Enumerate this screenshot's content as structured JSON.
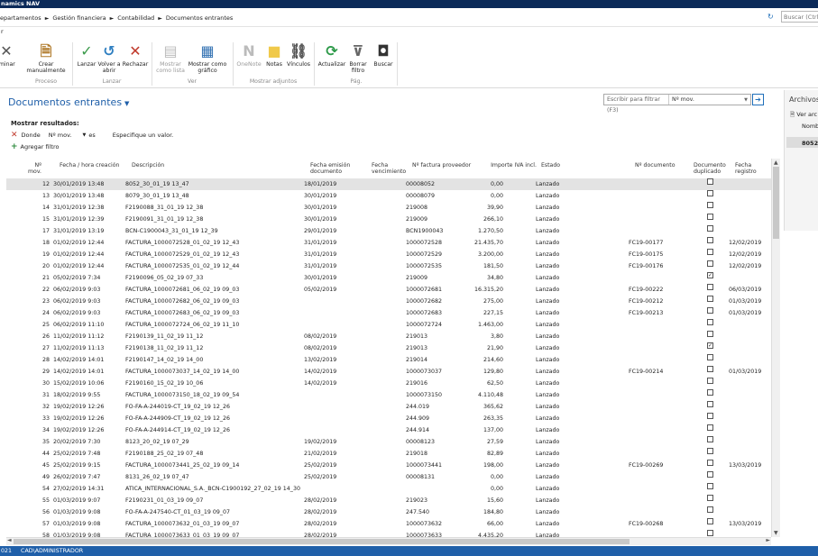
{
  "app": {
    "title": "namics NAV"
  },
  "nav": {
    "breadcrumb": [
      "epartamentos",
      "Gestión financiera",
      "Contabilidad",
      "Documentos entrantes"
    ],
    "search_placeholder": "Buscar (Ctrl+"
  },
  "menu": {
    "label": "r"
  },
  "ribbon": {
    "buttons": [
      {
        "label": "iminar",
        "icon": "delete-icon"
      },
      {
        "label": "Crear manualmente",
        "icon": "create-document-icon"
      },
      {
        "label": "Lanzar",
        "icon": "checkmark-icon"
      },
      {
        "label": "Volver a abrir",
        "icon": "reopen-icon"
      },
      {
        "label": "Rechazar",
        "icon": "reject-icon"
      },
      {
        "label": "Mostrar como lista",
        "icon": "list-view-icon"
      },
      {
        "label": "Mostrar como gráfico",
        "icon": "chart-view-icon"
      },
      {
        "label": "OneNote",
        "icon": "onenote-icon"
      },
      {
        "label": "Notas",
        "icon": "notes-icon"
      },
      {
        "label": "Vínculos",
        "icon": "links-icon"
      },
      {
        "label": "Actualizar",
        "icon": "refresh-icon"
      },
      {
        "label": "Borrar filtro",
        "icon": "clear-filter-icon"
      },
      {
        "label": "Buscar",
        "icon": "binoculars-icon"
      }
    ],
    "groups": [
      "Proceso",
      "Lanzar",
      "Ver",
      "Mostrar adjuntos",
      "Pág."
    ]
  },
  "page": {
    "title": "Documentos entrantes",
    "filter_placeholder": "Escribir para filtrar (F3)",
    "filter_field": "Nº mov."
  },
  "filters": {
    "show_label": "Mostrar resultados:",
    "where_label": "Donde",
    "field": "Nº mov.",
    "operator_label": "es",
    "value_placeholder": "Especifique un valor.",
    "add_label": "Agregar filtro"
  },
  "table": {
    "columns": [
      "Nº mov.",
      "Fecha / hora creación",
      "Descripción",
      "Fecha emisión documento",
      "Fecha vencimiento",
      "Nº factura proveedor",
      "Importe IVA incl.",
      "Estado",
      "Nº documento",
      "Documento duplicado",
      "Fecha registro"
    ],
    "rows": [
      {
        "no": "12",
        "created": "30/01/2019 13:48",
        "desc": "8052_30_01_19 13_47",
        "issue": "18/01/2019",
        "due": "",
        "inv": "00008052",
        "amt": "0,00",
        "status": "Lanzado",
        "doc": "",
        "dup": false,
        "reg": ""
      },
      {
        "no": "13",
        "created": "30/01/2019 13:48",
        "desc": "8079_30_01_19 13_48",
        "issue": "30/01/2019",
        "due": "",
        "inv": "00008079",
        "amt": "0,00",
        "status": "Lanzado",
        "doc": "",
        "dup": false,
        "reg": ""
      },
      {
        "no": "14",
        "created": "31/01/2019 12:38",
        "desc": "F2190088_31_01_19 12_38",
        "issue": "30/01/2019",
        "due": "",
        "inv": "219008",
        "amt": "39,90",
        "status": "Lanzado",
        "doc": "",
        "dup": false,
        "reg": ""
      },
      {
        "no": "15",
        "created": "31/01/2019 12:39",
        "desc": "F2190091_31_01_19 12_38",
        "issue": "30/01/2019",
        "due": "",
        "inv": "219009",
        "amt": "266,10",
        "status": "Lanzado",
        "doc": "",
        "dup": false,
        "reg": ""
      },
      {
        "no": "17",
        "created": "31/01/2019 13:19",
        "desc": "BCN-C1900043_31_01_19 12_39",
        "issue": "29/01/2019",
        "due": "",
        "inv": "BCN1900043",
        "amt": "1.270,50",
        "status": "Lanzado",
        "doc": "",
        "dup": false,
        "reg": ""
      },
      {
        "no": "18",
        "created": "01/02/2019 12:44",
        "desc": "FACTURA_1000072528_01_02_19 12_43",
        "issue": "31/01/2019",
        "due": "",
        "inv": "1000072528",
        "amt": "21.435,70",
        "status": "Lanzado",
        "doc": "FC19-00177",
        "dup": false,
        "reg": "12/02/2019"
      },
      {
        "no": "19",
        "created": "01/02/2019 12:44",
        "desc": "FACTURA_1000072529_01_02_19 12_43",
        "issue": "31/01/2019",
        "due": "",
        "inv": "1000072529",
        "amt": "3.200,00",
        "status": "Lanzado",
        "doc": "FC19-00175",
        "dup": false,
        "reg": "12/02/2019"
      },
      {
        "no": "20",
        "created": "01/02/2019 12:44",
        "desc": "FACTURA_1000072535_01_02_19 12_44",
        "issue": "31/01/2019",
        "due": "",
        "inv": "1000072535",
        "amt": "181,50",
        "status": "Lanzado",
        "doc": "FC19-00176",
        "dup": false,
        "reg": "12/02/2019"
      },
      {
        "no": "21",
        "created": "05/02/2019 7:34",
        "desc": "F2190096_05_02_19 07_33",
        "issue": "30/01/2019",
        "due": "",
        "inv": "219009",
        "amt": "34,80",
        "status": "Lanzado",
        "doc": "",
        "dup": true,
        "reg": ""
      },
      {
        "no": "22",
        "created": "06/02/2019 9:03",
        "desc": "FACTURA_1000072681_06_02_19 09_03",
        "issue": "05/02/2019",
        "due": "",
        "inv": "1000072681",
        "amt": "16.315,20",
        "status": "Lanzado",
        "doc": "FC19-00222",
        "dup": false,
        "reg": "06/03/2019"
      },
      {
        "no": "23",
        "created": "06/02/2019 9:03",
        "desc": "FACTURA_1000072682_06_02_19 09_03",
        "issue": "",
        "due": "",
        "inv": "1000072682",
        "amt": "275,00",
        "status": "Lanzado",
        "doc": "FC19-00212",
        "dup": false,
        "reg": "01/03/2019"
      },
      {
        "no": "24",
        "created": "06/02/2019 9:03",
        "desc": "FACTURA_1000072683_06_02_19 09_03",
        "issue": "",
        "due": "",
        "inv": "1000072683",
        "amt": "227,15",
        "status": "Lanzado",
        "doc": "FC19-00213",
        "dup": false,
        "reg": "01/03/2019"
      },
      {
        "no": "25",
        "created": "06/02/2019 11:10",
        "desc": "FACTURA_1000072724_06_02_19 11_10",
        "issue": "",
        "due": "",
        "inv": "1000072724",
        "amt": "1.463,00",
        "status": "Lanzado",
        "doc": "",
        "dup": false,
        "reg": ""
      },
      {
        "no": "26",
        "created": "11/02/2019 11:12",
        "desc": "F2190139_11_02_19 11_12",
        "issue": "08/02/2019",
        "due": "",
        "inv": "219013",
        "amt": "3,80",
        "status": "Lanzado",
        "doc": "",
        "dup": false,
        "reg": ""
      },
      {
        "no": "27",
        "created": "11/02/2019 11:13",
        "desc": "F2190138_11_02_19 11_12",
        "issue": "08/02/2019",
        "due": "",
        "inv": "219013",
        "amt": "21,90",
        "status": "Lanzado",
        "doc": "",
        "dup": true,
        "reg": ""
      },
      {
        "no": "28",
        "created": "14/02/2019 14:01",
        "desc": "F2190147_14_02_19 14_00",
        "issue": "13/02/2019",
        "due": "",
        "inv": "219014",
        "amt": "214,60",
        "status": "Lanzado",
        "doc": "",
        "dup": false,
        "reg": ""
      },
      {
        "no": "29",
        "created": "14/02/2019 14:01",
        "desc": "FACTURA_1000073037_14_02_19 14_00",
        "issue": "14/02/2019",
        "due": "",
        "inv": "1000073037",
        "amt": "129,80",
        "status": "Lanzado",
        "doc": "FC19-00214",
        "dup": false,
        "reg": "01/03/2019"
      },
      {
        "no": "30",
        "created": "15/02/2019 10:06",
        "desc": "F2190160_15_02_19 10_06",
        "issue": "14/02/2019",
        "due": "",
        "inv": "219016",
        "amt": "62,50",
        "status": "Lanzado",
        "doc": "",
        "dup": false,
        "reg": ""
      },
      {
        "no": "31",
        "created": "18/02/2019 9:55",
        "desc": "FACTURA_1000073150_18_02_19 09_54",
        "issue": "",
        "due": "",
        "inv": "1000073150",
        "amt": "4.110,48",
        "status": "Lanzado",
        "doc": "",
        "dup": false,
        "reg": ""
      },
      {
        "no": "32",
        "created": "19/02/2019 12:26",
        "desc": "FO-FA-A-244019-CT_19_02_19 12_26",
        "issue": "",
        "due": "",
        "inv": "244.019",
        "amt": "365,62",
        "status": "Lanzado",
        "doc": "",
        "dup": false,
        "reg": ""
      },
      {
        "no": "33",
        "created": "19/02/2019 12:26",
        "desc": "FO-FA-A-244909-CT_19_02_19 12_26",
        "issue": "",
        "due": "",
        "inv": "244.909",
        "amt": "263,35",
        "status": "Lanzado",
        "doc": "",
        "dup": false,
        "reg": ""
      },
      {
        "no": "34",
        "created": "19/02/2019 12:26",
        "desc": "FO-FA-A-244914-CT_19_02_19 12_26",
        "issue": "",
        "due": "",
        "inv": "244.914",
        "amt": "137,00",
        "status": "Lanzado",
        "doc": "",
        "dup": false,
        "reg": ""
      },
      {
        "no": "35",
        "created": "20/02/2019 7:30",
        "desc": "8123_20_02_19 07_29",
        "issue": "19/02/2019",
        "due": "",
        "inv": "00008123",
        "amt": "27,59",
        "status": "Lanzado",
        "doc": "",
        "dup": false,
        "reg": ""
      },
      {
        "no": "44",
        "created": "25/02/2019 7:48",
        "desc": "F2190188_25_02_19 07_48",
        "issue": "21/02/2019",
        "due": "",
        "inv": "219018",
        "amt": "82,89",
        "status": "Lanzado",
        "doc": "",
        "dup": false,
        "reg": ""
      },
      {
        "no": "45",
        "created": "25/02/2019 9:15",
        "desc": "FACTURA_1000073441_25_02_19 09_14",
        "issue": "25/02/2019",
        "due": "",
        "inv": "1000073441",
        "amt": "198,00",
        "status": "Lanzado",
        "doc": "FC19-00269",
        "dup": false,
        "reg": "13/03/2019"
      },
      {
        "no": "49",
        "created": "26/02/2019 7:47",
        "desc": "8131_26_02_19 07_47",
        "issue": "25/02/2019",
        "due": "",
        "inv": "00008131",
        "amt": "0,00",
        "status": "Lanzado",
        "doc": "",
        "dup": false,
        "reg": ""
      },
      {
        "no": "54",
        "created": "27/02/2019 14:31",
        "desc": "ATICA_INTERNACIONAL_S.A._BCN-C1900192_27_02_19 14_30",
        "issue": "",
        "due": "",
        "inv": "",
        "amt": "0,00",
        "status": "Lanzado",
        "doc": "",
        "dup": false,
        "reg": ""
      },
      {
        "no": "55",
        "created": "01/03/2019 9:07",
        "desc": "F2190231_01_03_19 09_07",
        "issue": "28/02/2019",
        "due": "",
        "inv": "219023",
        "amt": "15,60",
        "status": "Lanzado",
        "doc": "",
        "dup": false,
        "reg": ""
      },
      {
        "no": "56",
        "created": "01/03/2019 9:08",
        "desc": "FO-FA-A-247540-CT_01_03_19 09_07",
        "issue": "28/02/2019",
        "due": "",
        "inv": "247.540",
        "amt": "184,80",
        "status": "Lanzado",
        "doc": "",
        "dup": false,
        "reg": ""
      },
      {
        "no": "57",
        "created": "01/03/2019 9:08",
        "desc": "FACTURA_1000073632_01_03_19 09_07",
        "issue": "28/02/2019",
        "due": "",
        "inv": "1000073632",
        "amt": "66,00",
        "status": "Lanzado",
        "doc": "FC19-00268",
        "dup": false,
        "reg": "13/03/2019"
      },
      {
        "no": "58",
        "created": "01/03/2019 9:08",
        "desc": "FACTURA_1000073633_01_03_19 09_07",
        "issue": "28/02/2019",
        "due": "",
        "inv": "1000073633",
        "amt": "4.435,20",
        "status": "Lanzado",
        "doc": "",
        "dup": false,
        "reg": ""
      }
    ]
  },
  "factbox": {
    "title": "Archivos d",
    "view_label": "Ver arc",
    "name_header": "Nombr",
    "name_value": "8052_3"
  },
  "status": {
    "left": "021",
    "user": "CAD\\ADMINISTRADOR"
  },
  "colors": {
    "title_bar": "#0b2a59",
    "status_bar": "#1f5fa9",
    "accent": "#1f5fa9",
    "selected_row": "#e3e3e3"
  }
}
